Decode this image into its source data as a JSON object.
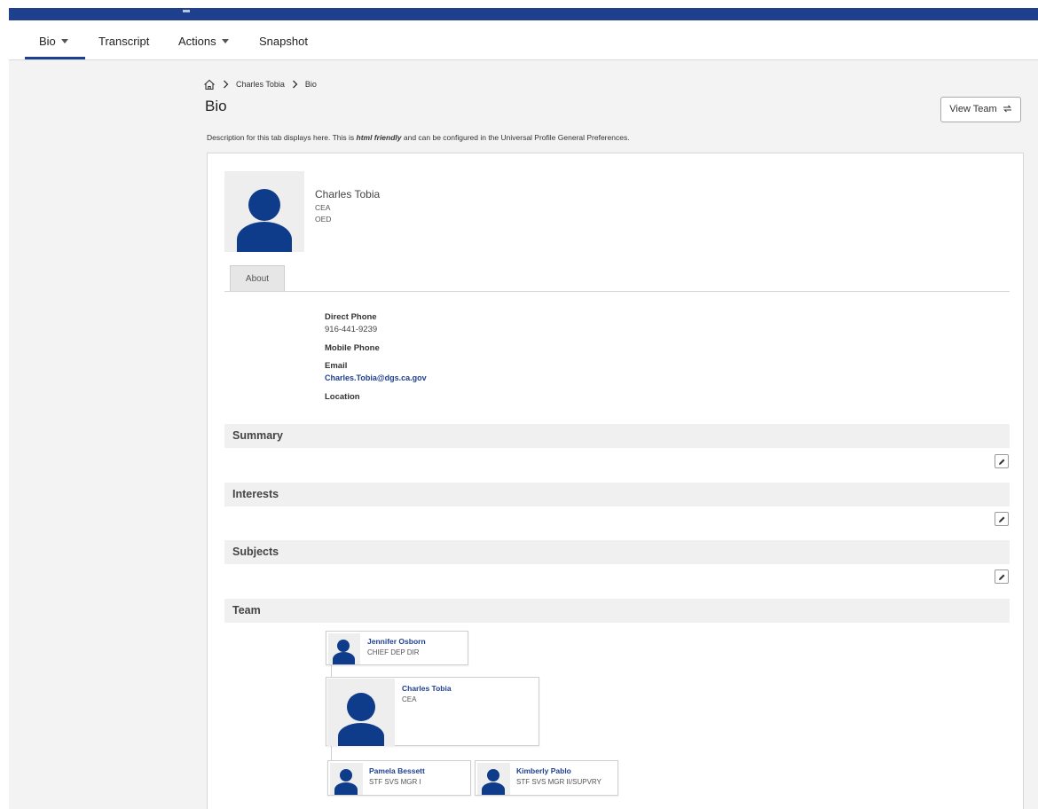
{
  "nav": {
    "bio": "Bio",
    "transcript": "Transcript",
    "actions": "Actions",
    "snapshot": "Snapshot"
  },
  "breadcrumb": {
    "person": "Charles Tobia",
    "current": "Bio"
  },
  "page": {
    "title": "Bio",
    "view_team_label": "View Team",
    "description_before": "Description for this tab displays here. This is ",
    "description_emphasis": "html friendly",
    "description_after": " and can be configured in the Universal Profile General Preferences."
  },
  "profile": {
    "name": "Charles Tobia",
    "title": "CEA",
    "org": "OED"
  },
  "tabs": {
    "about": "About"
  },
  "about": {
    "direct_phone_label": "Direct Phone",
    "direct_phone_value": "916-441-9239",
    "mobile_phone_label": "Mobile Phone",
    "email_label": "Email",
    "email_value": "Charles.Tobia@dgs.ca.gov",
    "location_label": "Location"
  },
  "sections": {
    "summary": "Summary",
    "interests": "Interests",
    "subjects": "Subjects",
    "team": "Team"
  },
  "team": {
    "manager": {
      "name": "Jennifer Osborn",
      "title": "CHIEF DEP DIR"
    },
    "self": {
      "name": "Charles Tobia",
      "title": "CEA"
    },
    "reports": [
      {
        "name": "Pamela Bessett",
        "title": "STF SVS MGR I"
      },
      {
        "name": "Kimberly Pablo",
        "title": "STF SVS MGR II/SUPVRY"
      }
    ]
  },
  "colors": {
    "brand": "#1f3f8f",
    "avatar": "#0f3c8a"
  },
  "icons": {
    "home": "home-icon",
    "chevron": "chevron-right-icon",
    "refresh": "refresh-icon",
    "edit": "pencil-icon",
    "caret": "caret-down-icon"
  }
}
